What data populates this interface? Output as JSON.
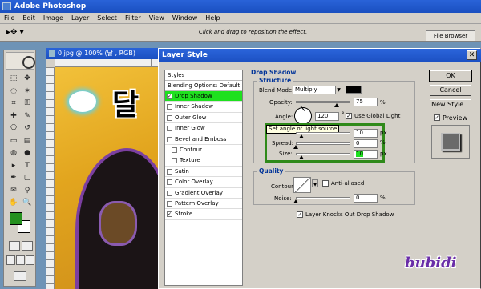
{
  "app": {
    "title": "Adobe Photoshop",
    "menu": [
      "File",
      "Edit",
      "Image",
      "Layer",
      "Select",
      "Filter",
      "View",
      "Window",
      "Help"
    ],
    "options_hint": "Click and drag to reposition the effect.",
    "file_browser_tab": "File Browser"
  },
  "toolbox": {
    "foreground_color": "#25901f",
    "background_color": "#ffffff",
    "icons": [
      "marquee-icon",
      "move-icon",
      "lasso-icon",
      "magic-wand-icon",
      "crop-icon",
      "slice-icon",
      "healing-brush-icon",
      "brush-icon",
      "clone-stamp-icon",
      "history-brush-icon",
      "eraser-icon",
      "gradient-icon",
      "blur-icon",
      "dodge-icon",
      "path-selection-icon",
      "type-icon",
      "pen-icon",
      "shape-icon",
      "notes-icon",
      "eyedropper-icon",
      "hand-icon",
      "zoom-icon"
    ]
  },
  "document": {
    "title": "0.jpg @ 100% (달 , RGB)",
    "hangul_text": "달"
  },
  "dialog": {
    "title": "Layer Style",
    "styles_header": "Styles",
    "blending_options": "Blending Options: Default",
    "styles": [
      {
        "label": "Drop Shadow",
        "checked": true,
        "selected": true,
        "indent": false
      },
      {
        "label": "Inner Shadow",
        "checked": false,
        "selected": false,
        "indent": false
      },
      {
        "label": "Outer Glow",
        "checked": false,
        "selected": false,
        "indent": false
      },
      {
        "label": "Inner Glow",
        "checked": false,
        "selected": false,
        "indent": false
      },
      {
        "label": "Bevel and Emboss",
        "checked": false,
        "selected": false,
        "indent": false
      },
      {
        "label": "Contour",
        "checked": false,
        "selected": false,
        "indent": true
      },
      {
        "label": "Texture",
        "checked": false,
        "selected": false,
        "indent": true
      },
      {
        "label": "Satin",
        "checked": false,
        "selected": false,
        "indent": false
      },
      {
        "label": "Color Overlay",
        "checked": false,
        "selected": false,
        "indent": false
      },
      {
        "label": "Gradient Overlay",
        "checked": false,
        "selected": false,
        "indent": false
      },
      {
        "label": "Pattern Overlay",
        "checked": false,
        "selected": false,
        "indent": false
      },
      {
        "label": "Stroke",
        "checked": true,
        "selected": false,
        "indent": false
      }
    ],
    "drop_shadow": {
      "section_title": "Drop Shadow",
      "structure_title": "Structure",
      "blend_mode_label": "Blend Mode:",
      "blend_mode_value": "Multiply",
      "shadow_color": "#000000",
      "opacity_label": "Opacity:",
      "opacity_value": "75",
      "opacity_unit": "%",
      "angle_label": "Angle:",
      "angle_value": "120",
      "angle_unit": "°",
      "use_global_light_label": "Use Global Light",
      "use_global_light": true,
      "tooltip": "Set angle of light source",
      "distance_value": "10",
      "distance_unit": "px",
      "spread_label": "Spread:",
      "spread_value": "0",
      "spread_unit": "%",
      "size_label": "Size:",
      "size_value": "10",
      "size_unit": "px"
    },
    "quality": {
      "title": "Quality",
      "contour_label": "Contour:",
      "anti_aliased_label": "Anti-aliased",
      "anti_aliased": false,
      "noise_label": "Noise:",
      "noise_value": "0",
      "noise_unit": "%",
      "knockout_label": "Layer Knocks Out Drop Shadow",
      "knockout": true
    },
    "buttons": {
      "ok": "OK",
      "cancel": "Cancel",
      "new_style": "New Style...",
      "preview_label": "Preview",
      "preview": true
    }
  },
  "watermark": "bubidi"
}
